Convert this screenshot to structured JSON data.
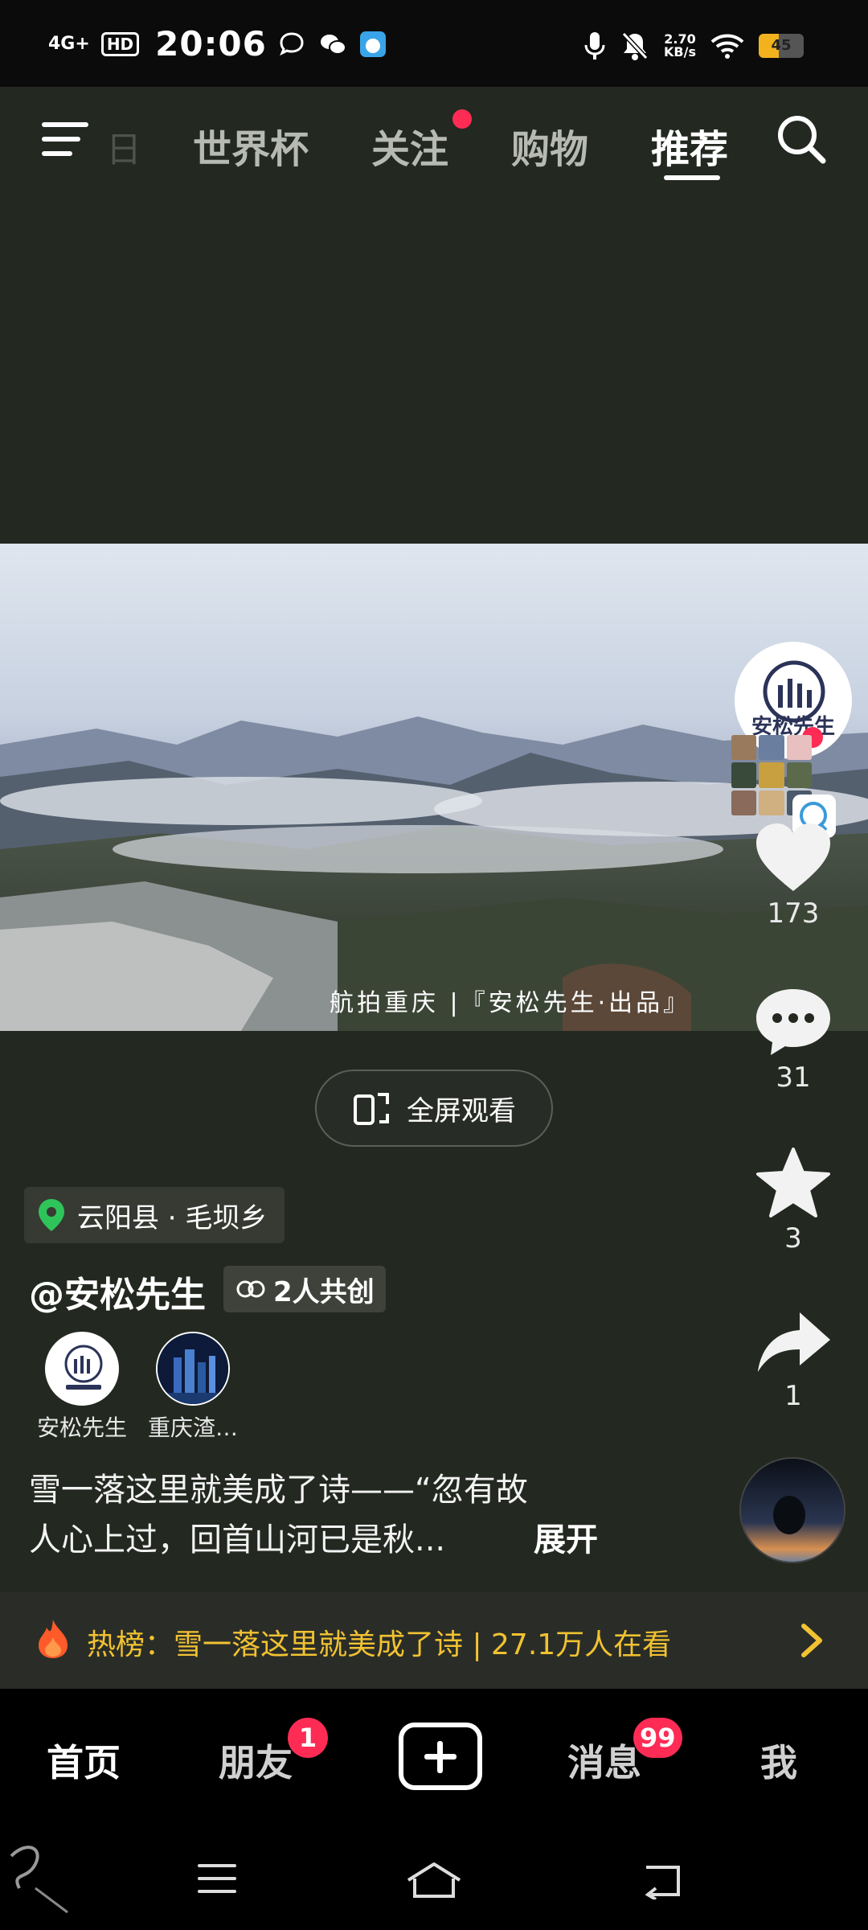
{
  "status_bar": {
    "network": "4G+",
    "hd": "HD",
    "time": "20:06",
    "speed": "2.70",
    "speed_unit": "KB/s",
    "battery": "45",
    "battery_level": 0.45
  },
  "top_nav": {
    "ghost_tab": "日",
    "tabs": [
      "世界杯",
      "关注",
      "购物",
      "推荐"
    ],
    "active_tab": "推荐"
  },
  "video": {
    "watermark": "航拍重庆 |『安松先生·出品』",
    "fullscreen_label": "全屏观看"
  },
  "actions": {
    "avatar_label": "安松先生",
    "like_count": "173",
    "comment_count": "31",
    "favorite_count": "3",
    "share_count": "1"
  },
  "info": {
    "location": "云阳县 · 毛坝乡",
    "author": "@安松先生",
    "cocreate": "2人共创",
    "creators": [
      "安松先生",
      "重庆渣…"
    ],
    "description_line1": "雪一落这里就美成了诗——“忽有故",
    "description_line2": "人心上过，回首山河已是秋...",
    "expand": "展开"
  },
  "hot": {
    "text": "热榜：雪一落这里就美成了诗 | 27.1万人在看"
  },
  "bottom_nav": {
    "items": [
      "首页",
      "朋友",
      "消息",
      "我"
    ],
    "friends_badge": "1",
    "messages_badge": "99"
  },
  "colors": {
    "accent": "#fe2c55",
    "background": "#232820",
    "hot_text": "#f1c232",
    "location_pin": "#2ec45a"
  },
  "icons": [
    "menu-icon",
    "search-icon",
    "heart-icon",
    "comment-icon",
    "star-icon",
    "share-icon",
    "location-pin-icon",
    "flame-icon",
    "chevron-right-icon",
    "fullscreen-icon",
    "cocreate-icon",
    "plus-icon",
    "recent-apps-icon",
    "home-icon",
    "back-icon"
  ]
}
